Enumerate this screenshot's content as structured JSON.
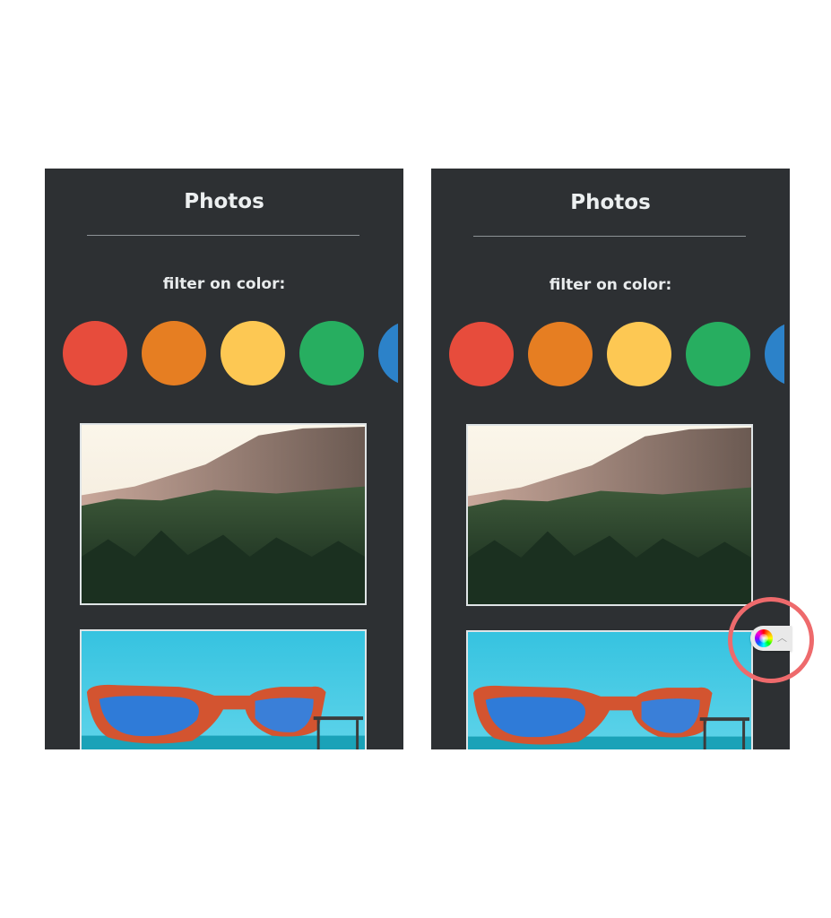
{
  "left_panel": {
    "title": "Photos",
    "filter_label": "filter on color:"
  },
  "right_panel": {
    "title": "Photos",
    "filter_label": "filter on color:"
  },
  "swatch_colors": [
    "#e74c3c",
    "#e67e22",
    "#fdc853",
    "#27ae60",
    "#2c82c9"
  ],
  "photos": [
    {
      "name": "forest-mountain-photo"
    },
    {
      "name": "flag-sunglasses-photo"
    }
  ],
  "color_picker_toggle": {
    "icon": "color-wheel-icon",
    "chevron": "chevron-up-icon"
  },
  "highlight_color": "#ee6a6c"
}
